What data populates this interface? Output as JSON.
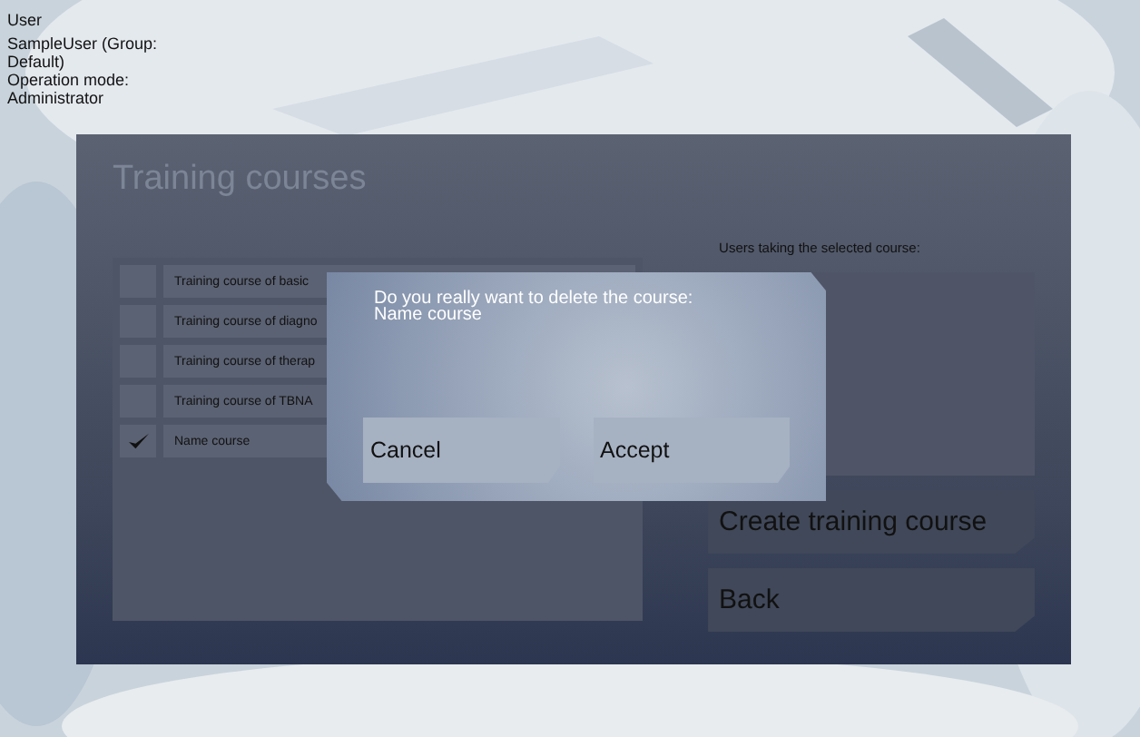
{
  "user_info": {
    "label": "User",
    "user": "SampleUser (Group: Default)",
    "mode": "Operation mode: Administrator"
  },
  "panel": {
    "title": "Training courses",
    "courses": [
      {
        "name": "Training course of basic",
        "checked": false
      },
      {
        "name": "Training course of diagno",
        "checked": false
      },
      {
        "name": "Training course of therap",
        "checked": false
      },
      {
        "name": "Training course of TBNA",
        "checked": false
      },
      {
        "name": "Name course",
        "checked": true
      }
    ],
    "users_label": "Users taking the selected course:",
    "buttons": [
      "Create training course",
      "Back"
    ]
  },
  "dialog": {
    "message": "Do you really want to delete the course:",
    "course": "Name course",
    "buttons": [
      "Cancel",
      "Accept"
    ]
  }
}
